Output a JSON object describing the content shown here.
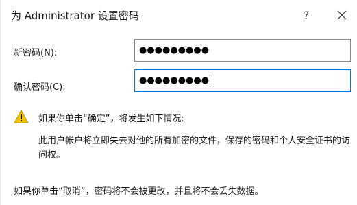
{
  "window": {
    "title": "为 Administrator 设置密码",
    "help_glyph": "?",
    "close_icon": "close-icon"
  },
  "form": {
    "new_password_label": "新密码(N):",
    "new_password_value": "●●●●●●●●●",
    "confirm_password_label": "确认密码(C):",
    "confirm_password_value": "●●●●●●●●●"
  },
  "warning": {
    "icon": "warning-icon",
    "icon_color": "#f2c200",
    "heading": "如果你单击“确定”，将发生如下情况:",
    "detail": "此用户帐户将立即失去对他的所有加密的文件，保存的密码和个人安全证书的访问权。"
  },
  "footer": {
    "cancel_note": "如果你单击“取消”，密码将不会被更改，并且将不会丢失数据。"
  },
  "colors": {
    "focus_border": "#0078d7",
    "input_border": "#8a8a8a"
  }
}
